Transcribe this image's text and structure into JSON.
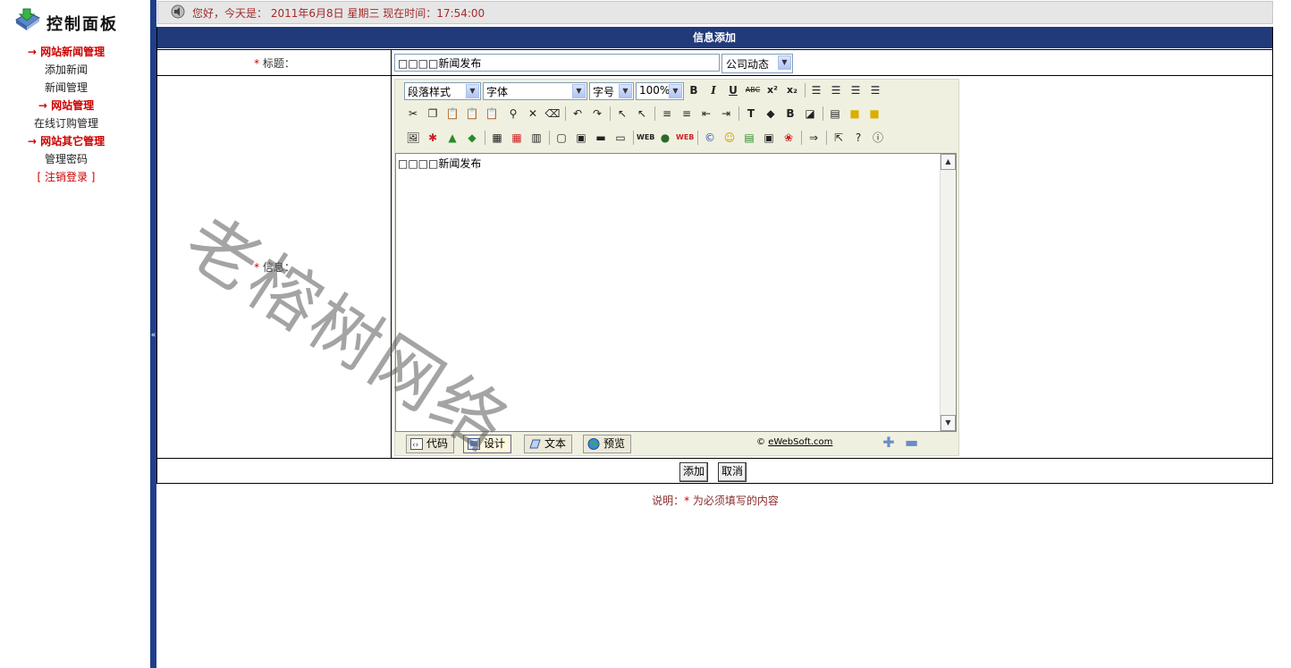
{
  "sidebar": {
    "logo_text": "控制面板",
    "items": [
      {
        "label": "→ 网站新闻管理",
        "kind": "group"
      },
      {
        "label": "添加新闻",
        "kind": "item"
      },
      {
        "label": "新闻管理",
        "kind": "item"
      },
      {
        "label": "→ 网站管理",
        "kind": "group"
      },
      {
        "label": "在线订购管理",
        "kind": "item"
      },
      {
        "label": "→ 网站其它管理",
        "kind": "group"
      },
      {
        "label": "管理密码",
        "kind": "item"
      }
    ],
    "logout": "[ 注销登录 ]"
  },
  "divider": {
    "toggle": "«"
  },
  "topbar": {
    "greeting": "您好，今天是： 2011年6月8日 星期三 现在时间：17:54:00"
  },
  "form": {
    "header": "信息添加",
    "required_star": "*",
    "title_label": "标题：",
    "title_value": "□□□□新闻发布",
    "category_value": "公司动态",
    "info_label": "信息：",
    "submit_label": "添加",
    "cancel_label": "取消",
    "note_prefix": "说明：",
    "note_suffix": " 为必须填写的内容"
  },
  "editor": {
    "selects": {
      "paragraph": "段落样式",
      "font": "字体",
      "size": "字号",
      "zoom": "100%"
    },
    "content": "□□□□新闻发布",
    "modes": [
      "代码",
      "设计",
      "文本",
      "预览"
    ],
    "active_mode": "设计",
    "credit_prefix": "© ",
    "credit_link": "eWebSoft.com"
  },
  "watermark": "老榕树网络",
  "colors": {
    "header_bg": "#213a7a",
    "accent_red": "#cc0000"
  }
}
